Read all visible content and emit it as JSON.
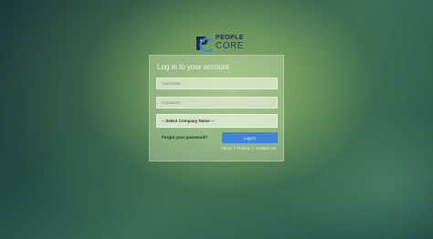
{
  "brand": {
    "line1": "PEOPLE",
    "line2": "CORE",
    "logo_icon": "people-core-logo-icon",
    "colors": {
      "mark_dark": "#1c2f3f",
      "mark_blue": "#3d86d9"
    }
  },
  "login": {
    "title": "Log in to your account",
    "username_placeholder": "Username",
    "password_placeholder": "Password",
    "company_select": "-- Select Company Name --",
    "forgot_label": "Forgot your password?",
    "submit_label": "Log In",
    "submit_color": "#3d86d9"
  },
  "footer": {
    "links": [
      "About",
      "Privacy",
      "Contact Us"
    ],
    "separator": "|"
  }
}
